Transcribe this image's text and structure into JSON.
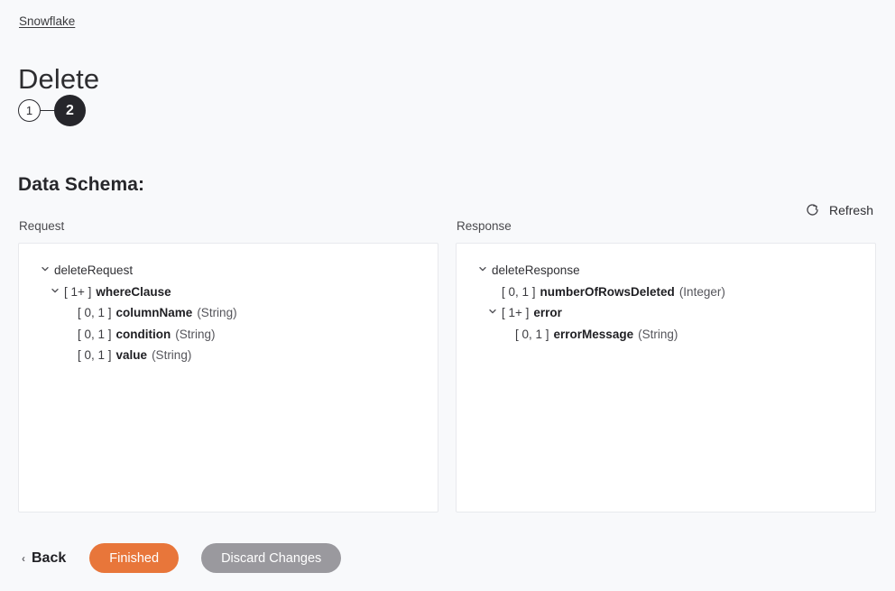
{
  "breadcrumb": {
    "label": "Snowflake"
  },
  "header": {
    "title": "Delete"
  },
  "stepper": {
    "steps": [
      {
        "label": "1",
        "state": "inactive"
      },
      {
        "label": "2",
        "state": "active"
      }
    ]
  },
  "section": {
    "heading": "Data Schema:"
  },
  "columns": {
    "request_label": "Request",
    "response_label": "Response"
  },
  "refresh": {
    "label": "Refresh",
    "icon": "refresh-icon"
  },
  "request_schema": {
    "nodes": [
      {
        "chevron": "chevron-down-icon",
        "cardinality": "",
        "name": "deleteRequest",
        "type": "",
        "level": 0,
        "bold": false
      },
      {
        "chevron": "chevron-down-icon",
        "cardinality": "[ 1+ ]",
        "name": "whereClause",
        "type": "",
        "level": 1,
        "bold": true
      },
      {
        "chevron": "",
        "cardinality": "[ 0, 1 ]",
        "name": "columnName",
        "type": "(String)",
        "level": 2,
        "bold": true
      },
      {
        "chevron": "",
        "cardinality": "[ 0, 1 ]",
        "name": "condition",
        "type": "(String)",
        "level": 2,
        "bold": true
      },
      {
        "chevron": "",
        "cardinality": "[ 0, 1 ]",
        "name": "value",
        "type": "(String)",
        "level": 2,
        "bold": true
      }
    ]
  },
  "response_schema": {
    "nodes": [
      {
        "chevron": "chevron-down-icon",
        "cardinality": "",
        "name": "deleteResponse",
        "type": "",
        "level": 0,
        "bold": false
      },
      {
        "chevron": "",
        "cardinality": "[ 0, 1 ]",
        "name": "numberOfRowsDeleted",
        "type": "(Integer)",
        "level": 1,
        "bold": true
      },
      {
        "chevron": "chevron-down-icon",
        "cardinality": "[ 1+ ]",
        "name": "error",
        "type": "",
        "level": 1,
        "bold": true
      },
      {
        "chevron": "",
        "cardinality": "[ 0, 1 ]",
        "name": "errorMessage",
        "type": "(String)",
        "level": 2,
        "bold": true
      }
    ]
  },
  "footer": {
    "back_label": "Back",
    "back_icon": "chevron-left-icon",
    "finished_label": "Finished",
    "discard_label": "Discard Changes"
  },
  "colors": {
    "page_background": "#f8f9fb",
    "panel_background": "#ffffff",
    "panel_border": "#e8e9ed",
    "accent_primary": "#e8763a",
    "accent_secondary": "#9a999e",
    "step_active": "#26262b",
    "text_primary": "#1f1f23"
  }
}
